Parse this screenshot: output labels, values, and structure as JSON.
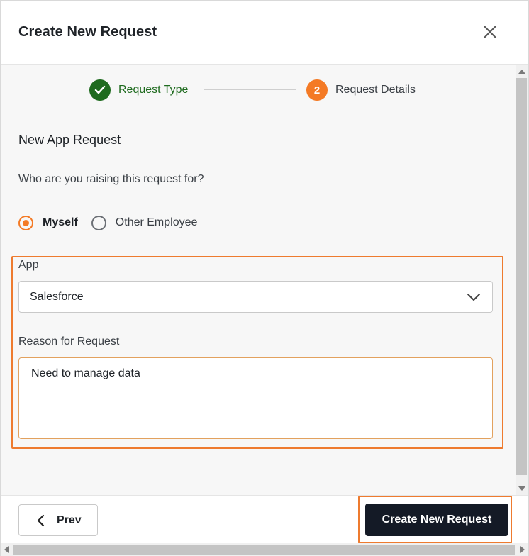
{
  "header": {
    "title": "Create New Request",
    "close_icon": "close-icon"
  },
  "stepper": {
    "steps": [
      {
        "label": "Request Type",
        "state": "completed",
        "icon": "check-icon",
        "color": "#1f6b1f"
      },
      {
        "label": "Request Details",
        "number": "2",
        "state": "active",
        "color": "#f47a25"
      }
    ]
  },
  "form": {
    "section_title": "New App Request",
    "question": "Who are you raising this request for?",
    "radio_options": [
      {
        "label": "Myself",
        "selected": true
      },
      {
        "label": "Other Employee",
        "selected": false
      }
    ],
    "app_label": "App",
    "app_value": "Salesforce",
    "reason_label": "Reason for Request",
    "reason_value": "Need to manage data"
  },
  "footer": {
    "prev_label": "Prev",
    "create_label": "Create New Request"
  },
  "colors": {
    "accent": "#f47a25",
    "success": "#1f6b1f",
    "primary_button": "#141a26",
    "highlight": "#ee7b2f"
  }
}
